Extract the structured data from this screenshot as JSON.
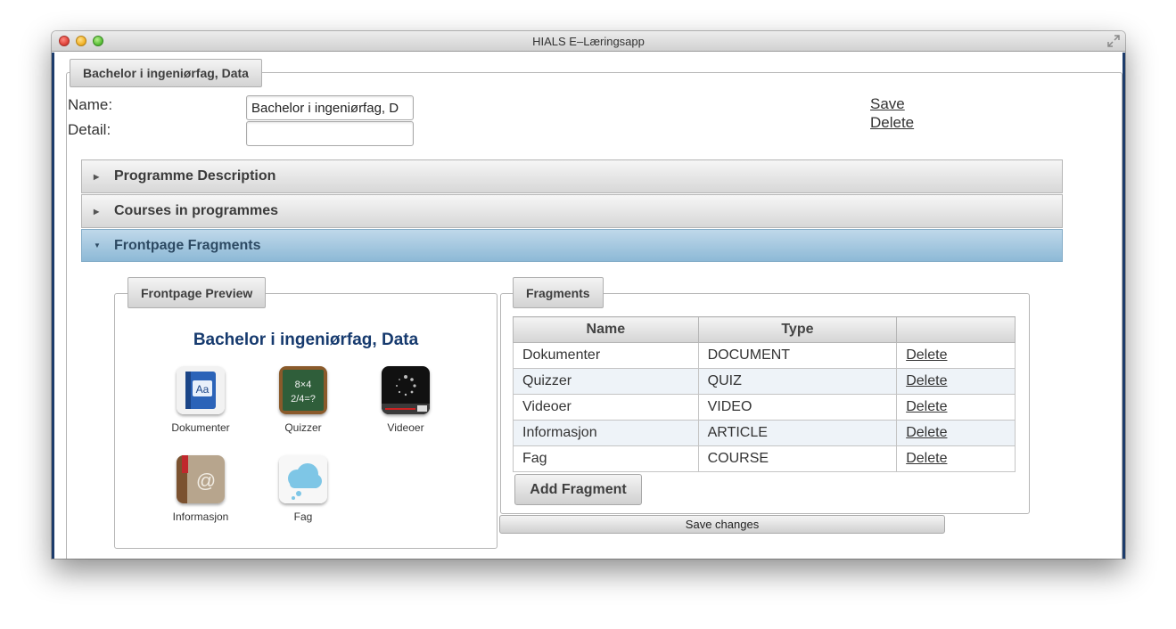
{
  "window": {
    "title": "HIALS E–Læringsapp"
  },
  "programme": {
    "tab_label": "Bachelor i ingeniørfag, Data",
    "name_label": "Name:",
    "detail_label": "Detail:",
    "name_value": "Bachelor i ingeniørfag, D",
    "detail_value": "",
    "save_link": "Save",
    "delete_link": "Delete"
  },
  "accordion": [
    {
      "label": "Programme Description",
      "expanded": false
    },
    {
      "label": "Courses in programmes",
      "expanded": false
    },
    {
      "label": "Frontpage Fragments",
      "expanded": true
    }
  ],
  "preview": {
    "legend": "Frontpage Preview",
    "title": "Bachelor i ingeniørfag, Data",
    "tiles": [
      {
        "label": "Dokumenter",
        "icon": "book-icon"
      },
      {
        "label": "Quizzer",
        "icon": "chalkboard-icon"
      },
      {
        "label": "Videoer",
        "icon": "video-icon"
      },
      {
        "label": "Informasjon",
        "icon": "address-book-icon"
      },
      {
        "label": "Fag",
        "icon": "cloud-icon"
      }
    ]
  },
  "fragments": {
    "legend": "Fragments",
    "columns": [
      "Name",
      "Type",
      ""
    ],
    "rows": [
      {
        "name": "Dokumenter",
        "type": "DOCUMENT",
        "action": "Delete"
      },
      {
        "name": "Quizzer",
        "type": "QUIZ",
        "action": "Delete"
      },
      {
        "name": "Videoer",
        "type": "VIDEO",
        "action": "Delete"
      },
      {
        "name": "Informasjon",
        "type": "ARTICLE",
        "action": "Delete"
      },
      {
        "name": "Fag",
        "type": "COURSE",
        "action": "Delete"
      }
    ],
    "add_button": "Add Fragment",
    "save_button": "Save changes"
  },
  "colors": {
    "accent_blue_header": "#8db9d6",
    "title_blue": "#163a6e",
    "window_border": "#1d3c6b"
  }
}
